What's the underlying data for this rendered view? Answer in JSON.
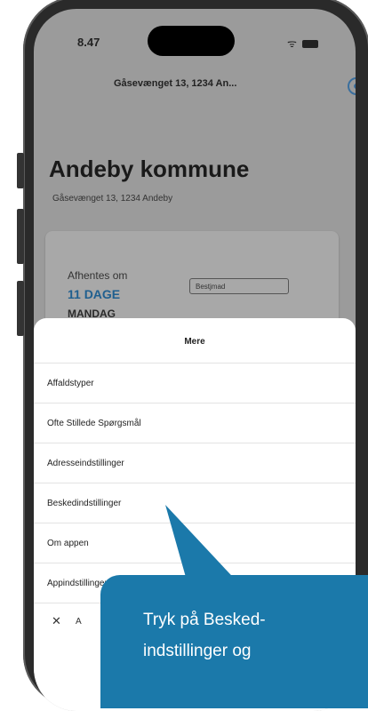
{
  "status": {
    "time": "8.47"
  },
  "header": {
    "address": "Gåsevænget 13, 1234 An..."
  },
  "municipality": {
    "title": "Andeby kommune",
    "address": "Gåsevænget 13, 1234 Andeby"
  },
  "pickup": {
    "label": "Afhentes om",
    "days": "11 DAGE",
    "weekday": "MANDAG",
    "button": "Bestjmad"
  },
  "sheet": {
    "title": "Mere",
    "items": [
      {
        "label": "Affaldstyper"
      },
      {
        "label": "Ofte Stillede Spørgsmål"
      },
      {
        "label": "Adresseindstillinger"
      },
      {
        "label": "Beskedindstillinger"
      },
      {
        "label": "Om appen"
      },
      {
        "label": "Appindstillinger"
      }
    ],
    "close_label": "A"
  },
  "callout": {
    "line1": "Tryk på Besked-",
    "line2": "indstillinger og"
  },
  "colors": {
    "accent": "#1b79aa",
    "link": "#1f5f8f"
  }
}
